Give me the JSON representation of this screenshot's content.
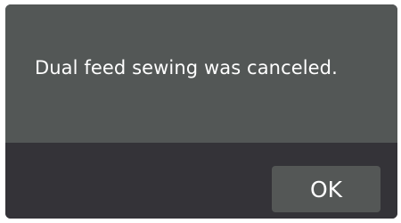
{
  "dialog": {
    "message": "Dual feed sewing was canceled.",
    "ok_label": "OK"
  },
  "colors": {
    "body_background": "#535756",
    "footer_background": "#343338",
    "button_background": "#545756",
    "text": "#ffffff"
  }
}
